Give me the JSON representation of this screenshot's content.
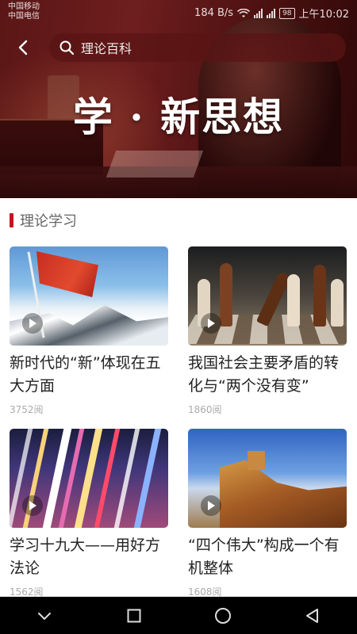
{
  "status_bar": {
    "carrier_1": "中国移动",
    "carrier_2": "中国电信",
    "speed": "184 B/s",
    "battery": "98",
    "time": "上午10:02"
  },
  "header": {
    "search_text": "理论百科",
    "hero_title": "学 · 新思想"
  },
  "section": {
    "title": "理论学习",
    "accent": "#c4161c"
  },
  "cards": [
    {
      "title": "新时代的“新”体现在五大方面",
      "reads": "3752阅"
    },
    {
      "title": "我国社会主要矛盾的转化与“两个没有变”",
      "reads": "1860阅"
    },
    {
      "title": "学习十九大——用好方法论",
      "reads": "1562阅"
    },
    {
      "title": "“四个伟大”构成一个有机整体",
      "reads": "1608阅"
    }
  ],
  "icons": {
    "back": "chevron-left-icon",
    "search": "search-icon",
    "play": "play-icon",
    "nav_back": "triangle-back-icon",
    "nav_home": "circle-home-icon",
    "nav_recent": "square-recent-icon",
    "nav_down": "chevron-down-icon"
  }
}
